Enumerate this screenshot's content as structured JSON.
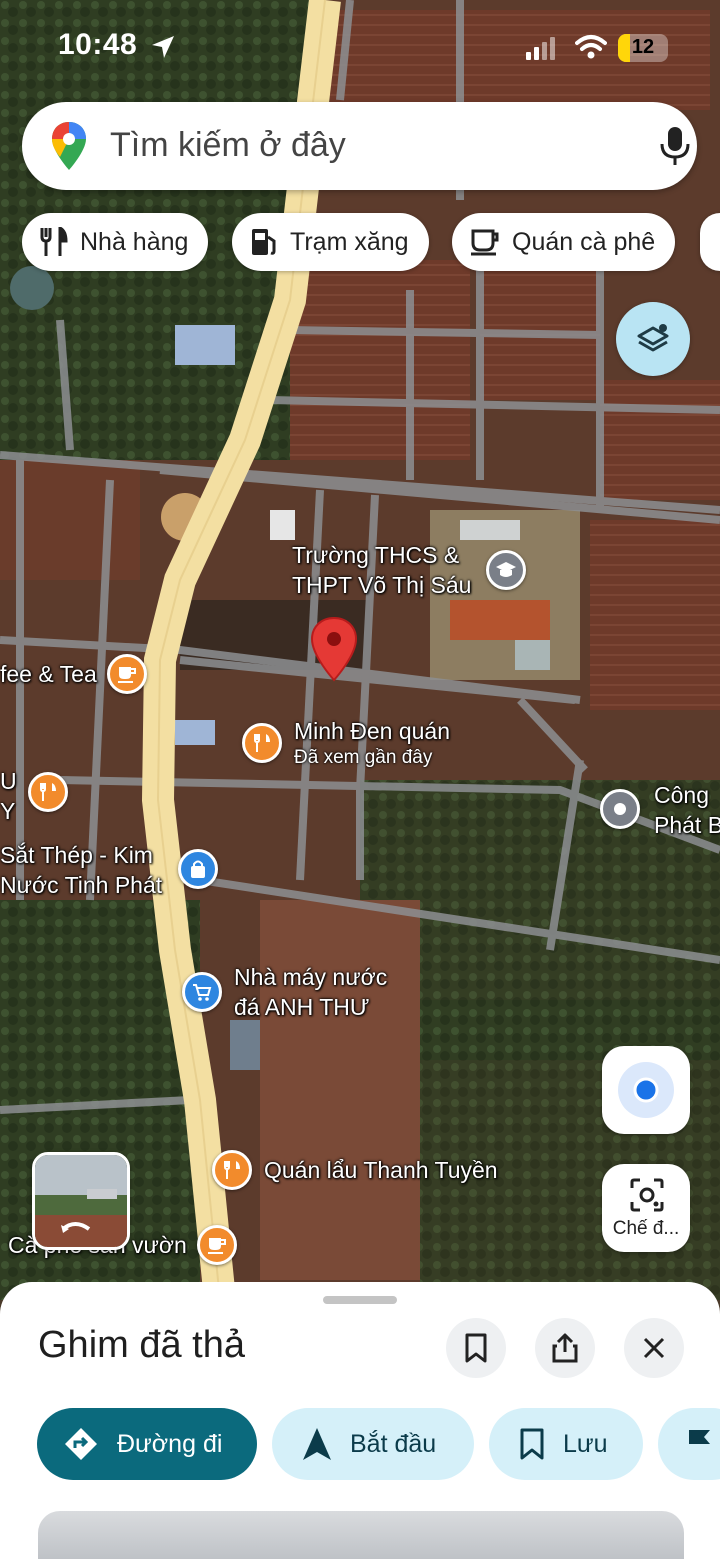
{
  "status_bar": {
    "time": "10:48",
    "battery": "12"
  },
  "search": {
    "placeholder": "Tìm kiếm ở đây"
  },
  "chips": [
    {
      "label": "Nhà hàng",
      "icon": "restaurant-icon"
    },
    {
      "label": "Trạm xăng",
      "icon": "gas-station-icon"
    },
    {
      "label": "Quán cà phê",
      "icon": "cafe-icon"
    }
  ],
  "map_places": {
    "school": "Trường THCS &",
    "school_2": "THPT Võ Thị Sáu",
    "cafe_tea": "fee & Tea",
    "minh_den": "Minh Đen quán",
    "minh_den_sub": "Đã xem gần đây",
    "u_line1": "U",
    "u_line2": "Y",
    "cong": "Công",
    "phat": "Phát B",
    "sat_thep": "Sắt Thép - Kim",
    "nuoc_tinh": "Nước Tinh Phát",
    "nha_may_1": "Nhà máy nước",
    "nha_may_2": "đá ANH THƯ",
    "quan_lau": "Quán lẩu Thanh Tuyền",
    "ca_phe": "Cà phê sân vườn"
  },
  "lens": {
    "label": "Chế đ..."
  },
  "sheet": {
    "title": "Ghim đã thả",
    "actions": {
      "directions": "Đường đi",
      "start": "Bắt đầu",
      "save": "Lưu"
    }
  },
  "colors": {
    "primary": "#0b6a7d",
    "chip_bg": "#d5f0f9",
    "road": "#f3dfa2",
    "pin_red": "#e53935"
  }
}
